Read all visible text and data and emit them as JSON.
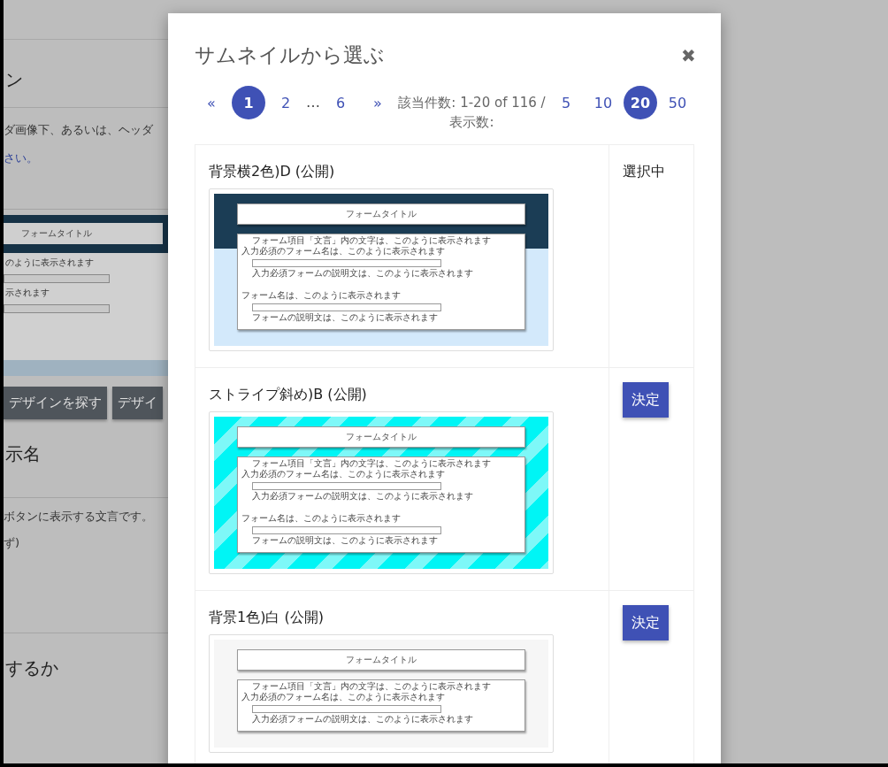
{
  "background": {
    "heading_1": "ン",
    "description": "ダ画像下、あるいは、ヘッダ",
    "link": "さい。",
    "preview": {
      "title": "フォームタイトル",
      "line_1": "のように表示されます",
      "line_2": "示されます"
    },
    "buttons": [
      "デザインを探す",
      "デザイ"
    ],
    "heading_2": "示名",
    "description_2": "ボタンに表示する文言です。",
    "note": "ず)",
    "heading_3": "するか"
  },
  "modal": {
    "title": "サムネイルから選ぶ",
    "close": "✖",
    "pagination": [
      {
        "kind": "prev",
        "label": "«"
      },
      {
        "kind": "page",
        "label": "1",
        "selected": true
      },
      {
        "kind": "page",
        "label": "2",
        "selected": false
      },
      {
        "kind": "ellipsis",
        "label": "…"
      },
      {
        "kind": "page",
        "label": "6",
        "selected": false
      },
      {
        "kind": "next",
        "label": "»"
      }
    ],
    "result_text": "該当件数: 1-20 of 116 / 表示数:",
    "page_sizes": [
      {
        "label": "5",
        "selected": false
      },
      {
        "label": "10",
        "selected": false
      },
      {
        "label": "20",
        "selected": true
      },
      {
        "label": "50",
        "selected": false
      }
    ],
    "designs": [
      {
        "name": "背景横2色)D (公開)",
        "selected": true,
        "action": "選択中",
        "thumbnail": {
          "kind": "two-tone",
          "title": "フォームタイトル",
          "note": "フォーム項目「文言」内の文字は、このように表示されます",
          "field_1_label": "入力必須のフォーム名は、このように表示されます",
          "field_1_help": "入力必須フォームの説明文は、このように表示されます",
          "field_2_label": "フォーム名は、このように表示されます",
          "field_2_help": "フォームの説明文は、このように表示されます"
        }
      },
      {
        "name": "ストライプ斜め)B (公開)",
        "selected": false,
        "action": "決定",
        "thumbnail": {
          "kind": "stripe",
          "title": "フォームタイトル",
          "note": "フォーム項目「文言」内の文字は、このように表示されます",
          "field_1_label": "入力必須のフォーム名は、このように表示されます",
          "field_1_help": "入力必須フォームの説明文は、このように表示されます",
          "field_2_label": "フォーム名は、このように表示されます",
          "field_2_help": "フォームの説明文は、このように表示されます"
        }
      },
      {
        "name": "背景1色)白 (公開)",
        "selected": false,
        "action": "決定",
        "thumbnail": {
          "kind": "plain",
          "title": "フォームタイトル",
          "note": "フォーム項目「文言」内の文字は、このように表示されます",
          "field_1_label": "入力必須のフォーム名は、このように表示されます",
          "field_1_help": "入力必須フォームの説明文は、このように表示されます"
        }
      }
    ]
  }
}
